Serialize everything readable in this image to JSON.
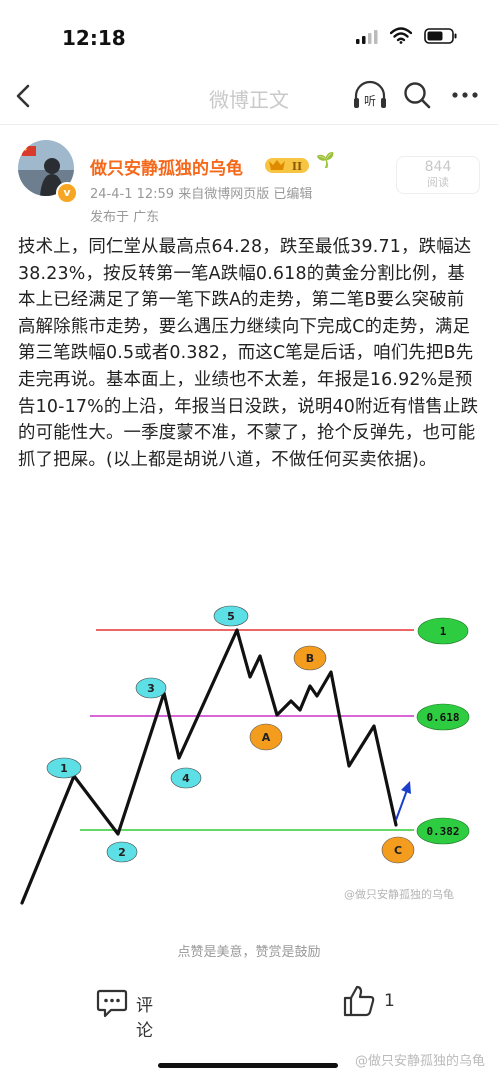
{
  "status": {
    "time": "12:18"
  },
  "nav": {
    "title": "微博正文",
    "listen_label": "听"
  },
  "author": {
    "name": "做只安静孤独的乌龟",
    "level_badge": "II",
    "meta": "24-4-1 12:59  来自微博网页版  已编辑",
    "location": "发布于 广东",
    "reads_count": "844",
    "reads_label": "阅读"
  },
  "post": {
    "text": "技术上，同仁堂从最高点64.28，跌至最低39.71，跌幅达38.23%，按反转第一笔A跌幅0.618的黄金分割比例，基本上已经满足了第一笔下跌A的走势，第二笔B要么突破前高解除熊市走势，要么遇压力继续向下完成C的走势，满足第三笔跌幅0.5或者0.382，而这C笔是后话，咱们先把B先走完再说。基本面上，业绩也不太差，年报是16.92%是预告10-17%的上沿，年报当日没跌，说明40附近有惜售止跌的可能性大。一季度蒙不准，不蒙了，抢个反弹先，也可能抓了把屎。(以上都是胡说八道，不做任何买卖依据)。"
  },
  "chart": {
    "labels": {
      "w1": "1",
      "w2": "2",
      "w3": "3",
      "w4": "4",
      "w5": "5",
      "a": "A",
      "b": "B",
      "c": "C",
      "lvl1": "1",
      "lvl618": "0.618",
      "lvl382": "0.382"
    },
    "watermark": "@做只安静孤独的乌龟",
    "colors": {
      "line_1": "#e63333",
      "line_618": "#cc33cc",
      "line_382": "#33cc33",
      "wave_badge": "#5ce0e6",
      "abc_badge": "#f39c1e",
      "level_badge": "#2ecc40"
    }
  },
  "hint": "点赞是美意，赞赏是鼓励",
  "bottom": {
    "comment_label": "评论",
    "like_count": "1",
    "watermark": "@做只安静孤独的乌龟"
  },
  "colors": {
    "author_name": "#f5691c",
    "nav_title": "#c9c9c9"
  }
}
